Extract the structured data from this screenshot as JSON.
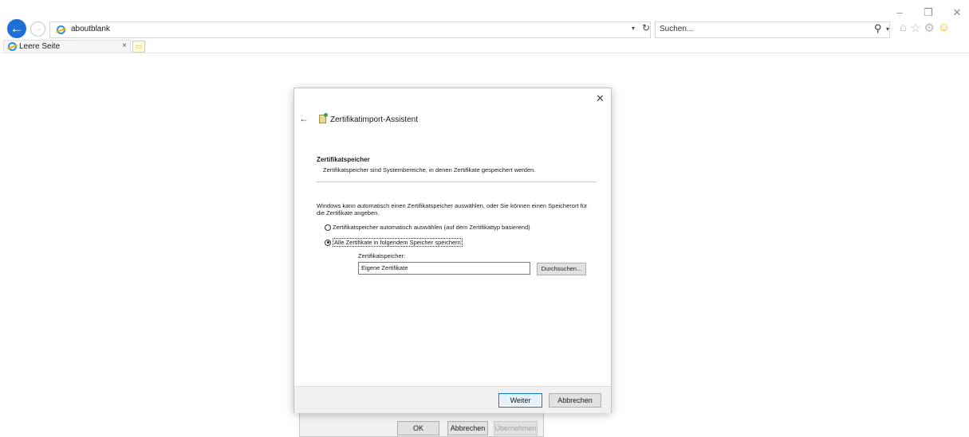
{
  "window_controls": {
    "minimize": "–",
    "restore": "❐",
    "close": "✕"
  },
  "nav": {
    "back_glyph": "←",
    "forward_glyph": "→"
  },
  "address": {
    "url": "aboutblank",
    "dropdown_glyph": "▾",
    "refresh_glyph": "↻"
  },
  "search": {
    "placeholder": "Suchen...",
    "icon_glyph": "⚲",
    "dropdown_glyph": "▾"
  },
  "toolbar": {
    "home_glyph": "⌂",
    "favorites_glyph": "☆",
    "settings_glyph": "⚙",
    "feedback_glyph": "☺"
  },
  "tabs": [
    {
      "title": "Leere Seite",
      "close_glyph": "×"
    }
  ],
  "new_tab_glyph": "▭",
  "background_dialog": {
    "buttons": [
      {
        "label": "OK"
      },
      {
        "label": "Abbrechen"
      },
      {
        "label": "Übernehmen",
        "disabled": true
      }
    ]
  },
  "wizard": {
    "close_glyph": "✕",
    "back_glyph": "←",
    "title": "Zertifikatimport-Assistent",
    "section_heading": "Zertifikatspeicher",
    "section_subtitle": "Zertifikatspeicher sind Systembereiche, in denen Zertifikate gespeichert werden.",
    "intro": "Windows kann automatisch einen Zertifikatspeicher auswählen, oder Sie können einen Speicherort für die Zertifikate angeben.",
    "radio_auto": {
      "label": "Zertifikatspeicher automatisch auswählen (auf dem Zertifikattyp basierend)",
      "checked": false
    },
    "radio_manual": {
      "label": "Alle Zertifikate in folgendem Speicher speichern",
      "checked": true
    },
    "store_label": "Zertifikatspeicher:",
    "store_value": "Eigene Zertifikate",
    "browse_label": "Durchsuchen...",
    "next_label": "Weiter",
    "cancel_label": "Abbrechen"
  }
}
